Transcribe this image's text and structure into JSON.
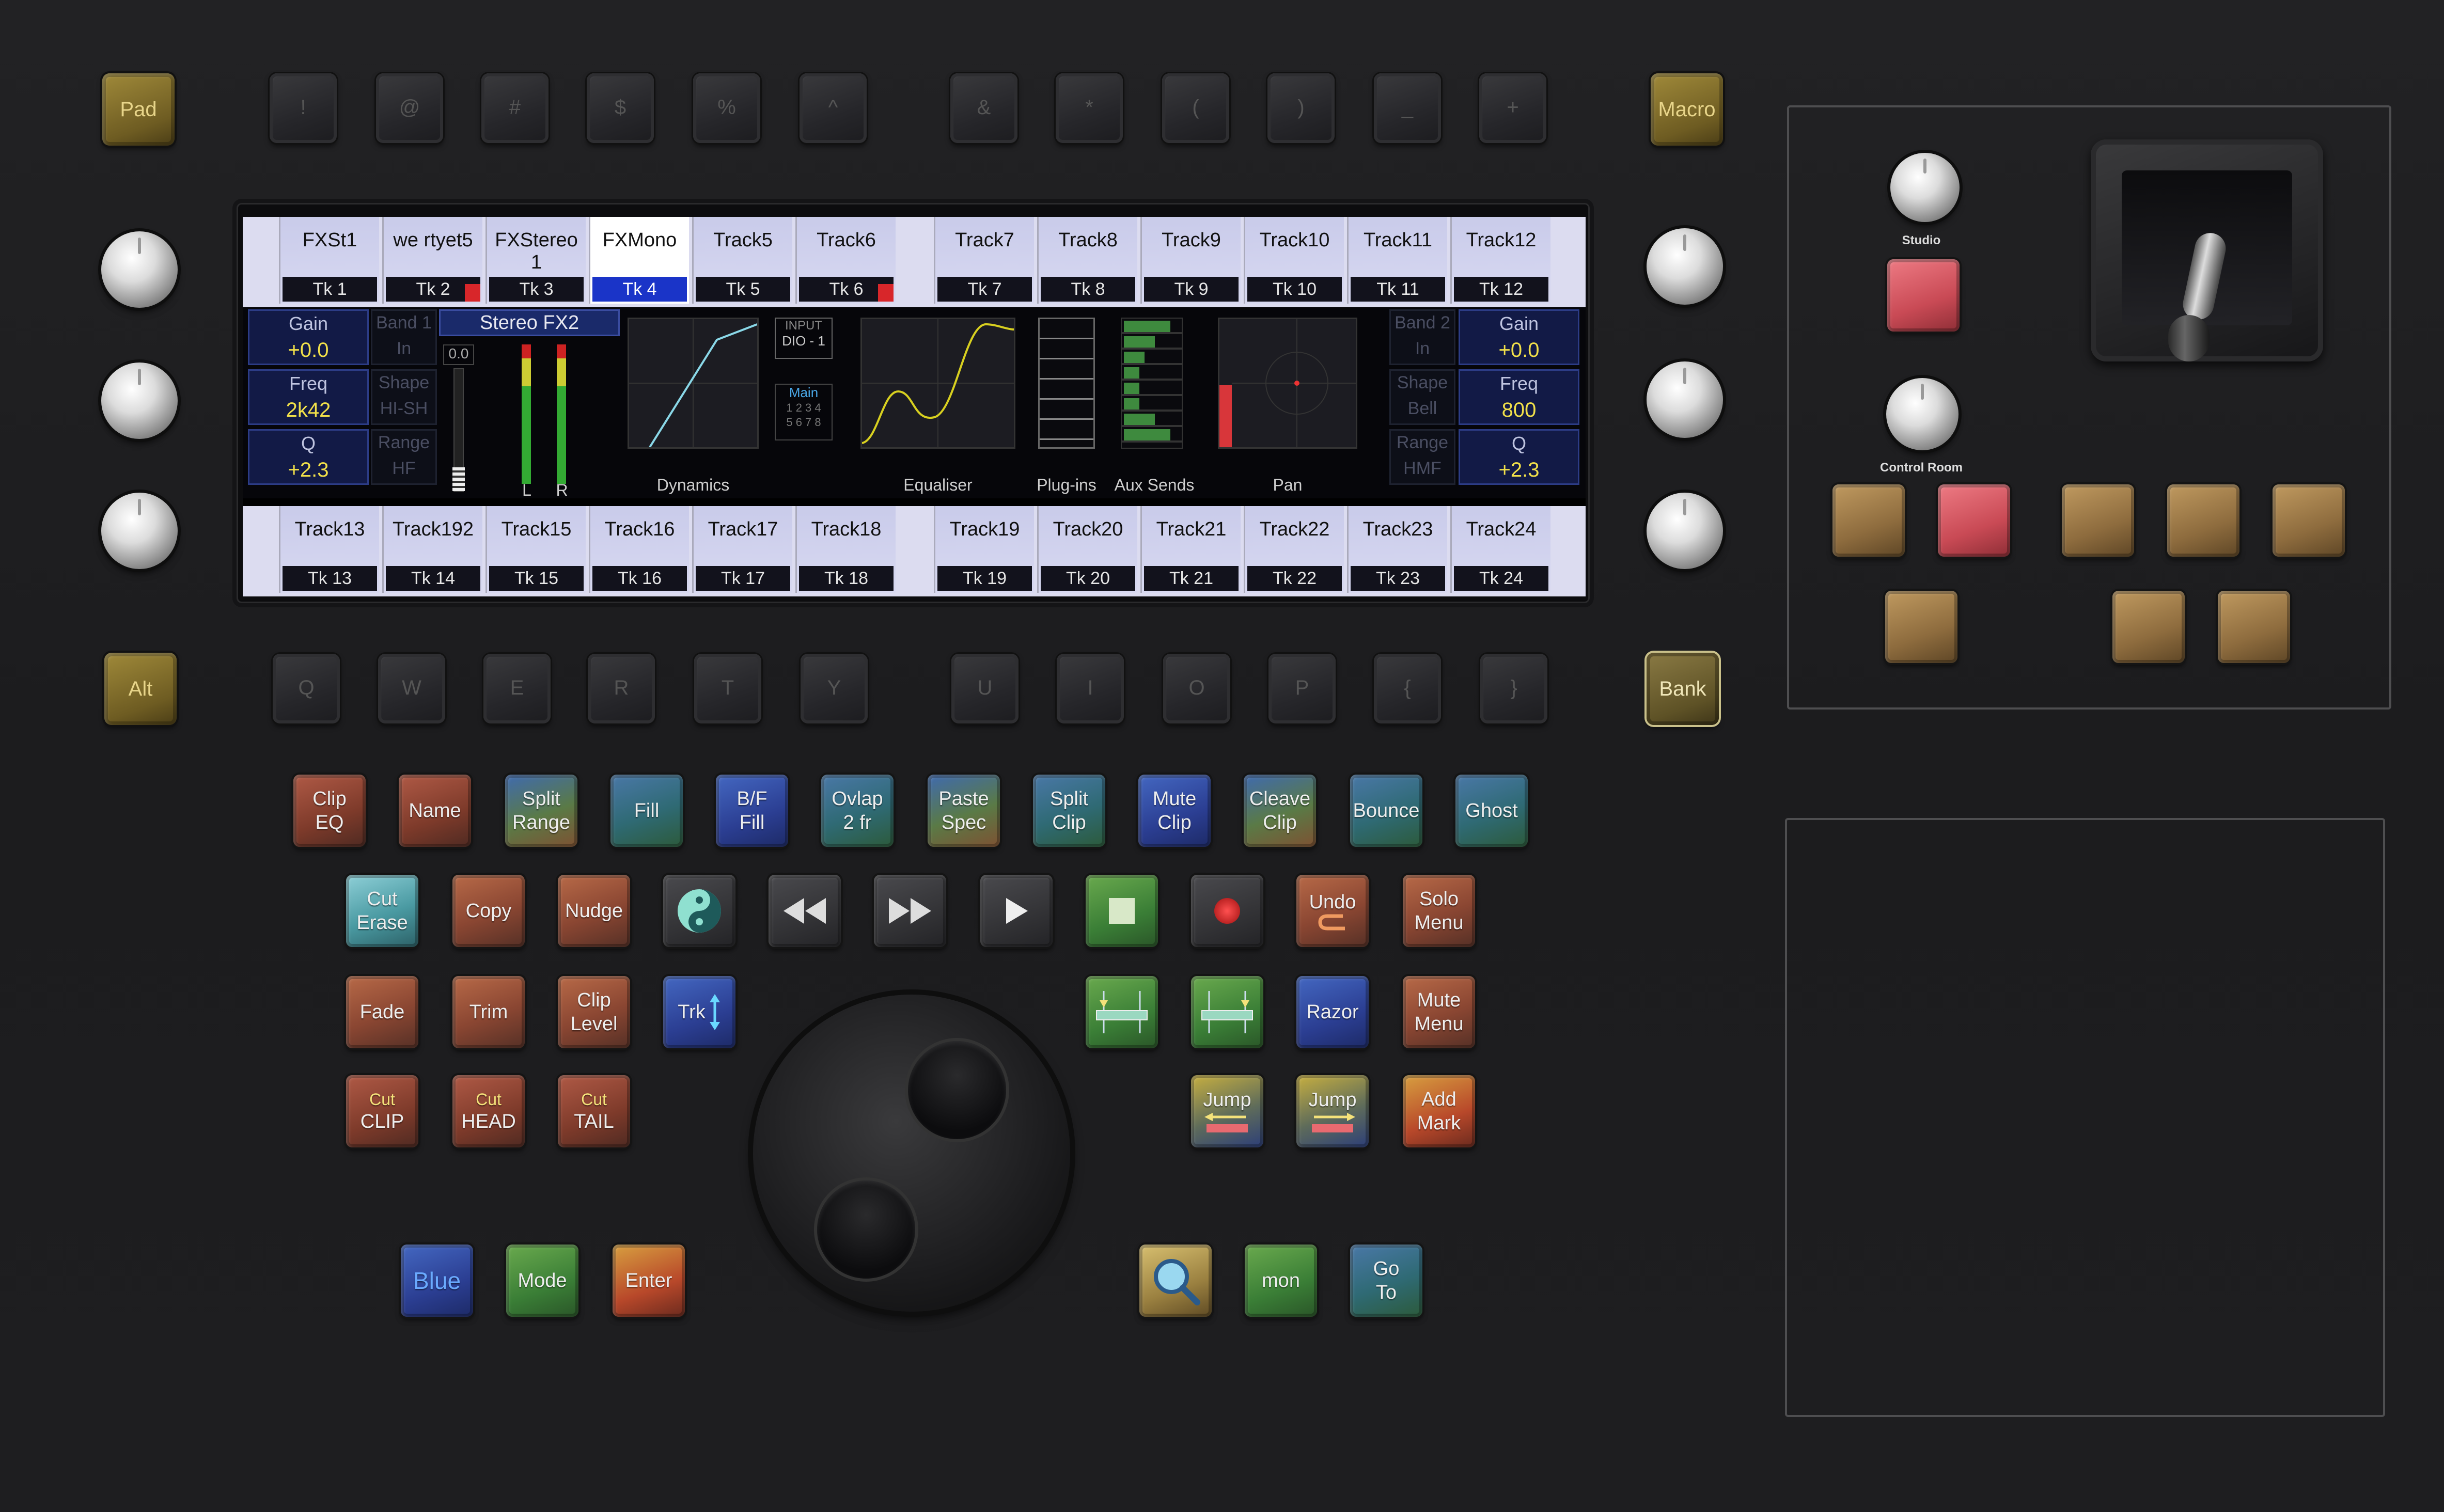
{
  "side_keys": {
    "pad": "Pad",
    "macro": "Macro",
    "alt": "Alt",
    "bank": "Bank"
  },
  "top_keys": [
    "!",
    "@",
    "#",
    "$",
    "%",
    "^",
    "&",
    "*",
    "(",
    ")",
    "_",
    "+"
  ],
  "lower_keys": [
    "Q",
    "W",
    "E",
    "R",
    "T",
    "Y",
    "U",
    "I",
    "O",
    "P",
    "{",
    "}"
  ],
  "tracks_top": [
    {
      "name": "FXSt1",
      "tk": "Tk 1",
      "selected": false,
      "flag": false
    },
    {
      "name": "we rtyet5",
      "tk": "Tk 2",
      "selected": false,
      "flag": true
    },
    {
      "name": "FXStereo 1",
      "tk": "Tk 3",
      "selected": false,
      "flag": false
    },
    {
      "name": "FXMono",
      "tk": "Tk 4",
      "selected": true,
      "flag": false
    },
    {
      "name": "Track5",
      "tk": "Tk 5",
      "selected": false,
      "flag": false
    },
    {
      "name": "Track6",
      "tk": "Tk 6",
      "selected": false,
      "flag": true
    },
    {
      "name": "Track7",
      "tk": "Tk 7",
      "selected": false,
      "flag": false
    },
    {
      "name": "Track8",
      "tk": "Tk 8",
      "selected": false,
      "flag": false
    },
    {
      "name": "Track9",
      "tk": "Tk 9",
      "selected": false,
      "flag": false
    },
    {
      "name": "Track10",
      "tk": "Tk 10",
      "selected": false,
      "flag": false
    },
    {
      "name": "Track11",
      "tk": "Tk 11",
      "selected": false,
      "flag": false
    },
    {
      "name": "Track12",
      "tk": "Tk 12",
      "selected": false,
      "flag": false
    }
  ],
  "tracks_bottom": [
    {
      "name": "Track13",
      "tk": "Tk 13"
    },
    {
      "name": "Track192",
      "tk": "Tk 14"
    },
    {
      "name": "Track15",
      "tk": "Tk 15"
    },
    {
      "name": "Track16",
      "tk": "Tk 16"
    },
    {
      "name": "Track17",
      "tk": "Tk 17"
    },
    {
      "name": "Track18",
      "tk": "Tk 18"
    },
    {
      "name": "Track19",
      "tk": "Tk 19"
    },
    {
      "name": "Track20",
      "tk": "Tk 20"
    },
    {
      "name": "Track21",
      "tk": "Tk 21"
    },
    {
      "name": "Track22",
      "tk": "Tk 22"
    },
    {
      "name": "Track23",
      "tk": "Tk 23"
    },
    {
      "name": "Track24",
      "tk": "Tk 24"
    }
  ],
  "strip": {
    "left": {
      "gain": {
        "label": "Gain",
        "value": "+0.0"
      },
      "band": {
        "label": "Band 1",
        "value": "In"
      },
      "freq": {
        "label": "Freq",
        "value": "2k42"
      },
      "shape": {
        "label": "Shape",
        "value": "HI-SH"
      },
      "q": {
        "label": "Q",
        "value": "+2.3"
      },
      "range": {
        "label": "Range",
        "value": "HF"
      }
    },
    "right": {
      "band": {
        "label": "Band 2",
        "value": "In"
      },
      "gain": {
        "label": "Gain",
        "value": "+0.0"
      },
      "shape": {
        "label": "Shape",
        "value": "Bell"
      },
      "freq": {
        "label": "Freq",
        "value": "800"
      },
      "range": {
        "label": "Range",
        "value": "HMF"
      },
      "q": {
        "label": "Q",
        "value": "+2.3"
      }
    },
    "channel_name": "Stereo FX2",
    "fader_value": "0.0",
    "meter_labels": [
      "L",
      "R"
    ],
    "input_label": "INPUT",
    "input_value": "DIO - 1",
    "main_label": "Main",
    "main_numbers": "1 2 3 4 5 6 7 8",
    "sections": {
      "dynamics": "Dynamics",
      "equaliser": "Equaliser",
      "plugins": "Plug-ins",
      "aux": "Aux Sends",
      "pan": "Pan"
    }
  },
  "monitor": {
    "studio_label": "Studio",
    "control_room_label": "Control Room"
  },
  "func_row1": [
    {
      "l1": "Clip",
      "l2": "EQ"
    },
    {
      "l1": "Name",
      "l2": ""
    },
    {
      "l1": "Split",
      "l2": "Range"
    },
    {
      "l1": "Fill",
      "l2": ""
    },
    {
      "l1": "B/F",
      "l2": "Fill"
    },
    {
      "l1": "Ovlap",
      "l2": "2 fr"
    },
    {
      "l1": "Paste",
      "l2": "Spec"
    },
    {
      "l1": "Split",
      "l2": "Clip"
    },
    {
      "l1": "Mute",
      "l2": "Clip"
    },
    {
      "l1": "Cleave",
      "l2": "Clip"
    },
    {
      "l1": "Bounce",
      "l2": ""
    },
    {
      "l1": "Ghost",
      "l2": ""
    }
  ],
  "func_keys": {
    "cut_erase": {
      "l1": "Cut",
      "l2": "Erase"
    },
    "copy": "Copy",
    "nudge": "Nudge",
    "undo": "Undo",
    "solo_menu": {
      "l1": "Solo",
      "l2": "Menu"
    },
    "fade": "Fade",
    "trim": "Trim",
    "clip_level": {
      "l1": "Clip",
      "l2": "Level"
    },
    "trk": "Trk",
    "razor": "Razor",
    "mute_menu": {
      "l1": "Mute",
      "l2": "Menu"
    },
    "cut_clip": {
      "l1": "Cut",
      "l2": "CLIP"
    },
    "cut_head": {
      "l1": "Cut",
      "l2": "HEAD"
    },
    "cut_tail": {
      "l1": "Cut",
      "l2": "TAIL"
    },
    "jump_left": "Jump",
    "jump_right": "Jump",
    "add_mark": {
      "l1": "Add",
      "l2": "Mark"
    },
    "blue": "Blue",
    "mode": "Mode",
    "enter": "Enter",
    "mon": "mon",
    "goto": {
      "l1": "Go",
      "l2": "To"
    }
  },
  "colors": {
    "selected_track": "#1a34c8",
    "param_value": "#f1e04a",
    "eq_curve": "#d8d020",
    "dyn_curve": "#8ad8e8",
    "aux_bar": "#3e8a3e"
  }
}
